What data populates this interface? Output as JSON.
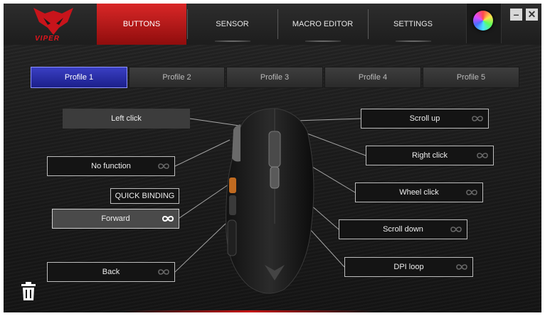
{
  "brand": {
    "name": "VIPER"
  },
  "tabs": [
    {
      "label": "BUTTONS"
    },
    {
      "label": "SENSOR"
    },
    {
      "label": "MACRO EDITOR"
    },
    {
      "label": "SETTINGS"
    }
  ],
  "window": {
    "minimize": "–",
    "close": "✕"
  },
  "profiles": [
    {
      "label": "Profile 1"
    },
    {
      "label": "Profile 2"
    },
    {
      "label": "Profile 3"
    },
    {
      "label": "Profile 4"
    },
    {
      "label": "Profile 5"
    }
  ],
  "left_buttons": {
    "left_click": "Left click",
    "side_top": "No function",
    "forward": "Forward",
    "back": "Back"
  },
  "right_buttons": {
    "scroll_up": "Scroll up",
    "right_click": "Right click",
    "wheel_click": "Wheel click",
    "scroll_down": "Scroll down",
    "dpi_loop": "DPI loop"
  },
  "quick_binding": "QUICK BINDING",
  "colors": {
    "accent_red": "#d92727",
    "profile_active": "#2a2fb0"
  },
  "icons": {
    "loop": "infinity-icon",
    "trash": "trash-icon",
    "color": "rgb-color-wheel-icon"
  }
}
